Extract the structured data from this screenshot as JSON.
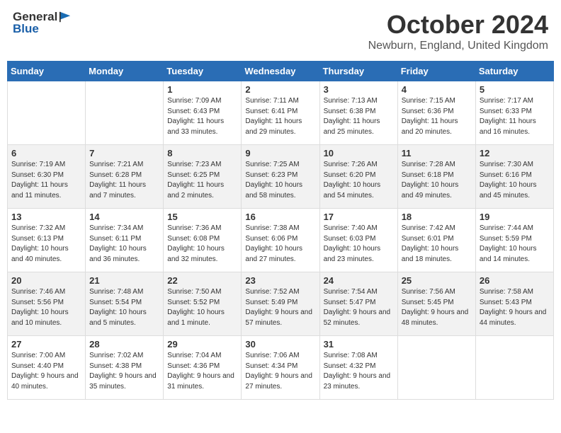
{
  "header": {
    "logo_general": "General",
    "logo_blue": "Blue",
    "month_year": "October 2024",
    "location": "Newburn, England, United Kingdom"
  },
  "weekdays": [
    "Sunday",
    "Monday",
    "Tuesday",
    "Wednesday",
    "Thursday",
    "Friday",
    "Saturday"
  ],
  "weeks": [
    [
      {
        "day": "",
        "sunrise": "",
        "sunset": "",
        "daylight": ""
      },
      {
        "day": "",
        "sunrise": "",
        "sunset": "",
        "daylight": ""
      },
      {
        "day": "1",
        "sunrise": "Sunrise: 7:09 AM",
        "sunset": "Sunset: 6:43 PM",
        "daylight": "Daylight: 11 hours and 33 minutes."
      },
      {
        "day": "2",
        "sunrise": "Sunrise: 7:11 AM",
        "sunset": "Sunset: 6:41 PM",
        "daylight": "Daylight: 11 hours and 29 minutes."
      },
      {
        "day": "3",
        "sunrise": "Sunrise: 7:13 AM",
        "sunset": "Sunset: 6:38 PM",
        "daylight": "Daylight: 11 hours and 25 minutes."
      },
      {
        "day": "4",
        "sunrise": "Sunrise: 7:15 AM",
        "sunset": "Sunset: 6:36 PM",
        "daylight": "Daylight: 11 hours and 20 minutes."
      },
      {
        "day": "5",
        "sunrise": "Sunrise: 7:17 AM",
        "sunset": "Sunset: 6:33 PM",
        "daylight": "Daylight: 11 hours and 16 minutes."
      }
    ],
    [
      {
        "day": "6",
        "sunrise": "Sunrise: 7:19 AM",
        "sunset": "Sunset: 6:30 PM",
        "daylight": "Daylight: 11 hours and 11 minutes."
      },
      {
        "day": "7",
        "sunrise": "Sunrise: 7:21 AM",
        "sunset": "Sunset: 6:28 PM",
        "daylight": "Daylight: 11 hours and 7 minutes."
      },
      {
        "day": "8",
        "sunrise": "Sunrise: 7:23 AM",
        "sunset": "Sunset: 6:25 PM",
        "daylight": "Daylight: 11 hours and 2 minutes."
      },
      {
        "day": "9",
        "sunrise": "Sunrise: 7:25 AM",
        "sunset": "Sunset: 6:23 PM",
        "daylight": "Daylight: 10 hours and 58 minutes."
      },
      {
        "day": "10",
        "sunrise": "Sunrise: 7:26 AM",
        "sunset": "Sunset: 6:20 PM",
        "daylight": "Daylight: 10 hours and 54 minutes."
      },
      {
        "day": "11",
        "sunrise": "Sunrise: 7:28 AM",
        "sunset": "Sunset: 6:18 PM",
        "daylight": "Daylight: 10 hours and 49 minutes."
      },
      {
        "day": "12",
        "sunrise": "Sunrise: 7:30 AM",
        "sunset": "Sunset: 6:16 PM",
        "daylight": "Daylight: 10 hours and 45 minutes."
      }
    ],
    [
      {
        "day": "13",
        "sunrise": "Sunrise: 7:32 AM",
        "sunset": "Sunset: 6:13 PM",
        "daylight": "Daylight: 10 hours and 40 minutes."
      },
      {
        "day": "14",
        "sunrise": "Sunrise: 7:34 AM",
        "sunset": "Sunset: 6:11 PM",
        "daylight": "Daylight: 10 hours and 36 minutes."
      },
      {
        "day": "15",
        "sunrise": "Sunrise: 7:36 AM",
        "sunset": "Sunset: 6:08 PM",
        "daylight": "Daylight: 10 hours and 32 minutes."
      },
      {
        "day": "16",
        "sunrise": "Sunrise: 7:38 AM",
        "sunset": "Sunset: 6:06 PM",
        "daylight": "Daylight: 10 hours and 27 minutes."
      },
      {
        "day": "17",
        "sunrise": "Sunrise: 7:40 AM",
        "sunset": "Sunset: 6:03 PM",
        "daylight": "Daylight: 10 hours and 23 minutes."
      },
      {
        "day": "18",
        "sunrise": "Sunrise: 7:42 AM",
        "sunset": "Sunset: 6:01 PM",
        "daylight": "Daylight: 10 hours and 18 minutes."
      },
      {
        "day": "19",
        "sunrise": "Sunrise: 7:44 AM",
        "sunset": "Sunset: 5:59 PM",
        "daylight": "Daylight: 10 hours and 14 minutes."
      }
    ],
    [
      {
        "day": "20",
        "sunrise": "Sunrise: 7:46 AM",
        "sunset": "Sunset: 5:56 PM",
        "daylight": "Daylight: 10 hours and 10 minutes."
      },
      {
        "day": "21",
        "sunrise": "Sunrise: 7:48 AM",
        "sunset": "Sunset: 5:54 PM",
        "daylight": "Daylight: 10 hours and 5 minutes."
      },
      {
        "day": "22",
        "sunrise": "Sunrise: 7:50 AM",
        "sunset": "Sunset: 5:52 PM",
        "daylight": "Daylight: 10 hours and 1 minute."
      },
      {
        "day": "23",
        "sunrise": "Sunrise: 7:52 AM",
        "sunset": "Sunset: 5:49 PM",
        "daylight": "Daylight: 9 hours and 57 minutes."
      },
      {
        "day": "24",
        "sunrise": "Sunrise: 7:54 AM",
        "sunset": "Sunset: 5:47 PM",
        "daylight": "Daylight: 9 hours and 52 minutes."
      },
      {
        "day": "25",
        "sunrise": "Sunrise: 7:56 AM",
        "sunset": "Sunset: 5:45 PM",
        "daylight": "Daylight: 9 hours and 48 minutes."
      },
      {
        "day": "26",
        "sunrise": "Sunrise: 7:58 AM",
        "sunset": "Sunset: 5:43 PM",
        "daylight": "Daylight: 9 hours and 44 minutes."
      }
    ],
    [
      {
        "day": "27",
        "sunrise": "Sunrise: 7:00 AM",
        "sunset": "Sunset: 4:40 PM",
        "daylight": "Daylight: 9 hours and 40 minutes."
      },
      {
        "day": "28",
        "sunrise": "Sunrise: 7:02 AM",
        "sunset": "Sunset: 4:38 PM",
        "daylight": "Daylight: 9 hours and 35 minutes."
      },
      {
        "day": "29",
        "sunrise": "Sunrise: 7:04 AM",
        "sunset": "Sunset: 4:36 PM",
        "daylight": "Daylight: 9 hours and 31 minutes."
      },
      {
        "day": "30",
        "sunrise": "Sunrise: 7:06 AM",
        "sunset": "Sunset: 4:34 PM",
        "daylight": "Daylight: 9 hours and 27 minutes."
      },
      {
        "day": "31",
        "sunrise": "Sunrise: 7:08 AM",
        "sunset": "Sunset: 4:32 PM",
        "daylight": "Daylight: 9 hours and 23 minutes."
      },
      {
        "day": "",
        "sunrise": "",
        "sunset": "",
        "daylight": ""
      },
      {
        "day": "",
        "sunrise": "",
        "sunset": "",
        "daylight": ""
      }
    ]
  ]
}
